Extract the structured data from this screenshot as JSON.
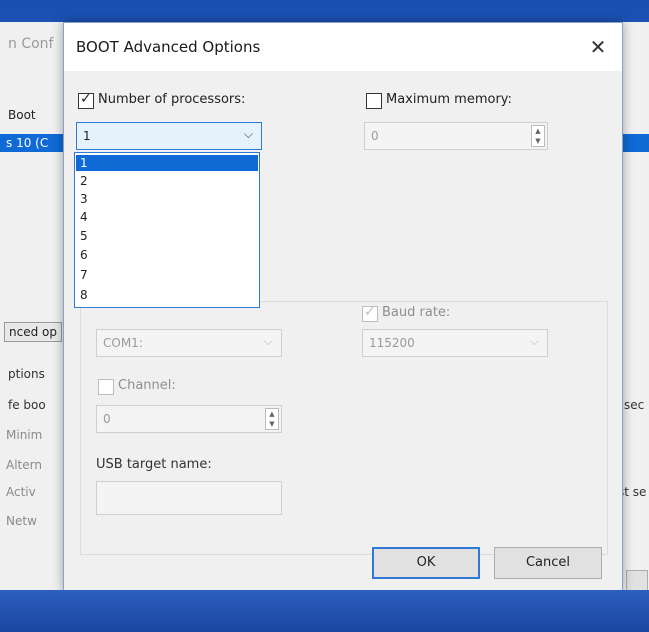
{
  "background_window": {
    "title": "n Conf",
    "tab": "Boot",
    "selected_entry": "s 10 (C",
    "advanced_button": "nced op",
    "options_label": "ptions",
    "safe_boot": "fe boo",
    "radio_minimal": "Minim",
    "radio_alternate": "Altern",
    "radio_active": "Activ",
    "radio_network": "Netw",
    "right_text_1": "sec",
    "right_text_2": "st se"
  },
  "dialog": {
    "title": "BOOT Advanced Options",
    "close_glyph": "✕",
    "num_processors": {
      "label": "Number of processors:",
      "checked": true,
      "value": "1"
    },
    "max_memory": {
      "label": "Maximum memory:",
      "checked": false,
      "value": "0"
    },
    "dropdown_options": [
      "1",
      "2",
      "3",
      "4",
      "5",
      "6",
      "7",
      "8"
    ],
    "debug_port": {
      "value": "COM1:"
    },
    "baud_rate": {
      "label": "Baud rate:",
      "checked": true,
      "value": "115200"
    },
    "channel": {
      "label": "Channel:",
      "checked": false,
      "value": "0"
    },
    "usb_target": {
      "label": "USB target name:",
      "value": ""
    },
    "ok_label": "OK",
    "cancel_label": "Cancel"
  },
  "icons": {
    "chevron": "⌵",
    "spin_up": "▲",
    "spin_down": "▼"
  },
  "colors": {
    "accent": "#0f6ad6",
    "focus_border": "#2e7ad6"
  }
}
